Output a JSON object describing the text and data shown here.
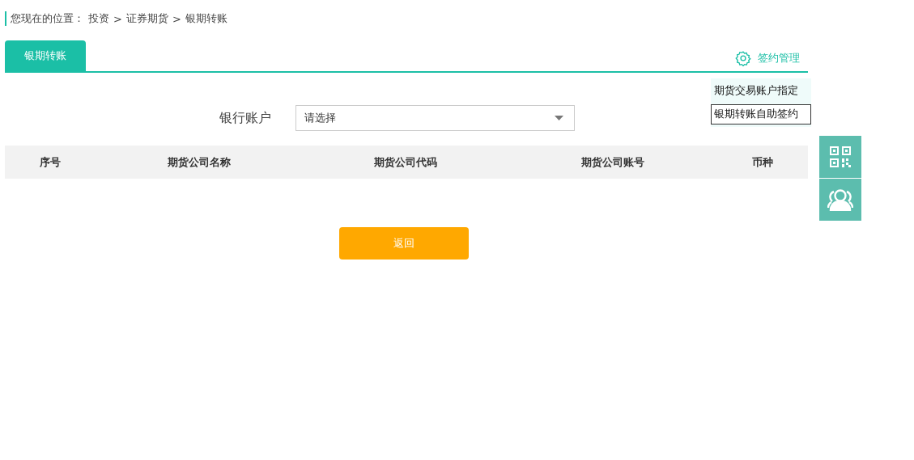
{
  "breadcrumb": {
    "label": "您现在的位置：",
    "items": [
      {
        "text": "投资"
      },
      {
        "separator": ">",
        "text": "证券期货"
      },
      {
        "separator": ">",
        "text": "银期转账"
      }
    ]
  },
  "tabs": [
    {
      "label": "银期转账",
      "selected": true
    }
  ],
  "sign_menu": {
    "label": "签约管理",
    "expanded": true,
    "items": [
      {
        "label": "期货交易账户指定",
        "selected": false
      },
      {
        "label": "银期转账自助签约",
        "selected": true
      }
    ]
  },
  "form": {
    "label": "银行账户",
    "select": {
      "placeholder": "请选择"
    }
  },
  "table": {
    "columns": [
      "序号",
      "期货公司名称",
      "期货公司代码",
      "期货公司账号",
      "币种"
    ]
  },
  "buttons": [
    {
      "label": "返回"
    }
  ],
  "side_tools": [
    {
      "kind": "qrcode"
    },
    {
      "kind": "contacts"
    }
  ]
}
